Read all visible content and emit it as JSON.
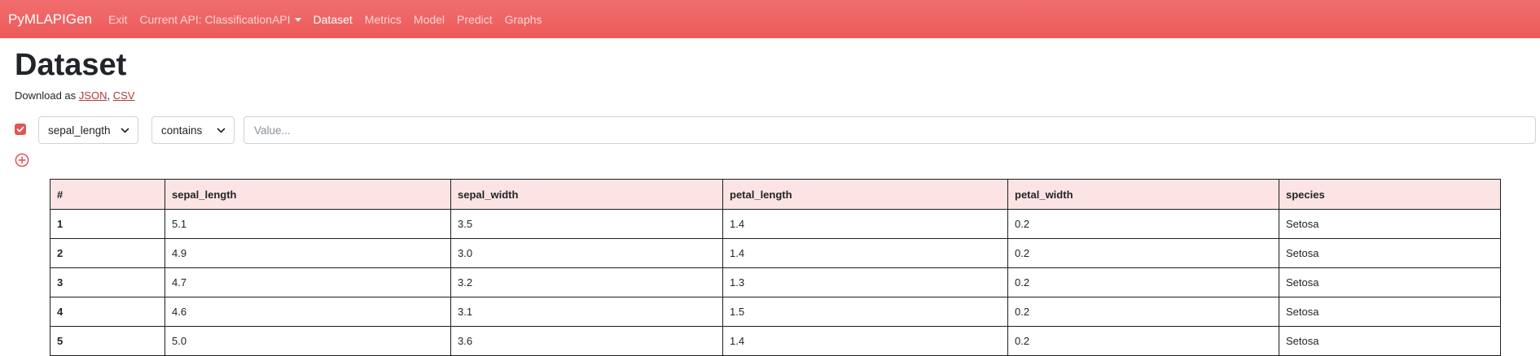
{
  "navbar": {
    "brand": "PyMLAPIGen",
    "links": [
      {
        "label": "Exit"
      },
      {
        "label": "Current API: ClassificationAPI"
      },
      {
        "label": "Dataset"
      },
      {
        "label": "Metrics"
      },
      {
        "label": "Model"
      },
      {
        "label": "Predict"
      },
      {
        "label": "Graphs"
      }
    ],
    "active": "Dataset",
    "color": "#ef5f5f"
  },
  "page": {
    "title": "Dataset",
    "download_prefix": "Download as",
    "download_json": "JSON",
    "download_sep": ",",
    "download_csv": "CSV"
  },
  "filter": {
    "enabled": true,
    "column": "sepal_length",
    "operator": "contains",
    "value": "",
    "placeholder": "Value..."
  },
  "table": {
    "headers": [
      "#",
      "sepal_length",
      "sepal_width",
      "petal_length",
      "petal_width",
      "species"
    ],
    "rows": [
      [
        "1",
        "5.1",
        "3.5",
        "1.4",
        "0.2",
        "Setosa"
      ],
      [
        "2",
        "4.9",
        "3.0",
        "1.4",
        "0.2",
        "Setosa"
      ],
      [
        "3",
        "4.7",
        "3.2",
        "1.3",
        "0.2",
        "Setosa"
      ],
      [
        "4",
        "4.6",
        "3.1",
        "1.5",
        "0.2",
        "Setosa"
      ],
      [
        "5",
        "5.0",
        "3.6",
        "1.4",
        "0.2",
        "Setosa"
      ]
    ]
  }
}
